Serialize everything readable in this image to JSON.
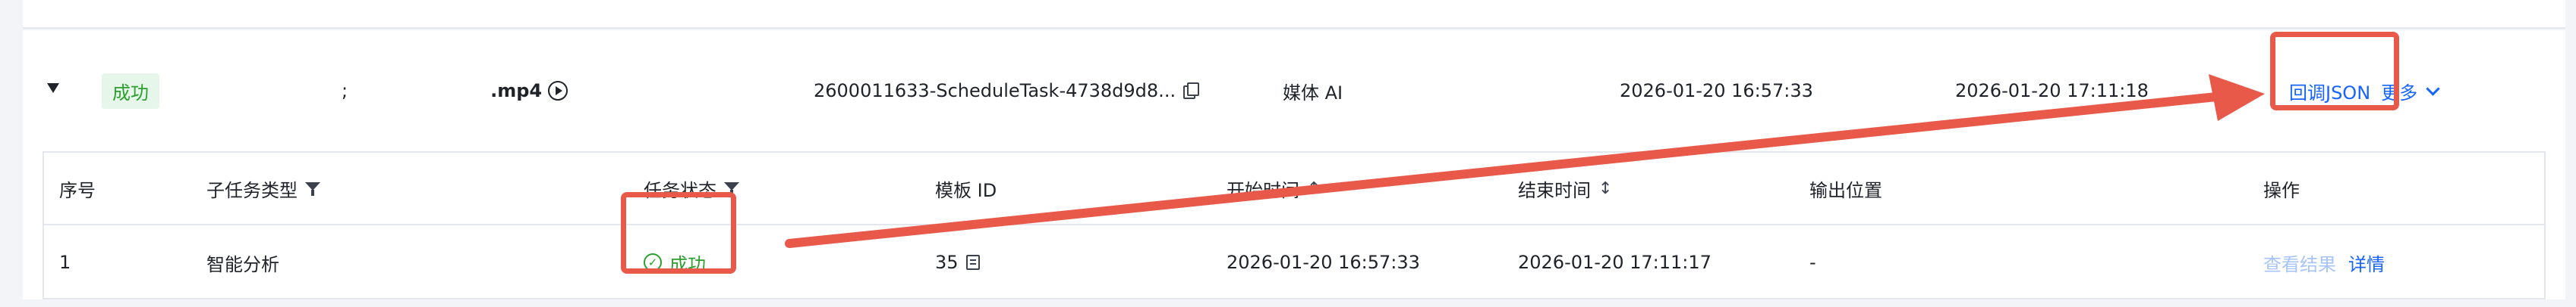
{
  "task": {
    "status_badge": "成功",
    "file_name_suffix": ".mp4",
    "file_name_prefix": ";",
    "task_id": "2600011633-ScheduleTask-4738d9d8...",
    "task_type": "媒体 AI",
    "start_time": "2026-01-20 16:57:33",
    "end_time": "2026-01-20 17:11:18",
    "callback_json_label": "回调JSON",
    "more_label": "更多"
  },
  "subtask_table": {
    "columns": {
      "index": "序号",
      "subtask_type": "子任务类型",
      "task_status": "任务状态",
      "template_id": "模板 ID",
      "start_time": "开始时间",
      "end_time": "结束时间",
      "output_location": "输出位置",
      "actions": "操作"
    },
    "rows": [
      {
        "index": "1",
        "subtask_type": "智能分析",
        "status": "成功",
        "template_id": "35",
        "start_time": "2026-01-20 16:57:33",
        "end_time": "2026-01-20 17:11:17",
        "output_location": "-",
        "view_result_label": "查看结果",
        "details_label": "详情"
      }
    ]
  },
  "colors": {
    "annotation": "#e9594a",
    "success": "#2ba02d",
    "link": "#1664ff"
  }
}
